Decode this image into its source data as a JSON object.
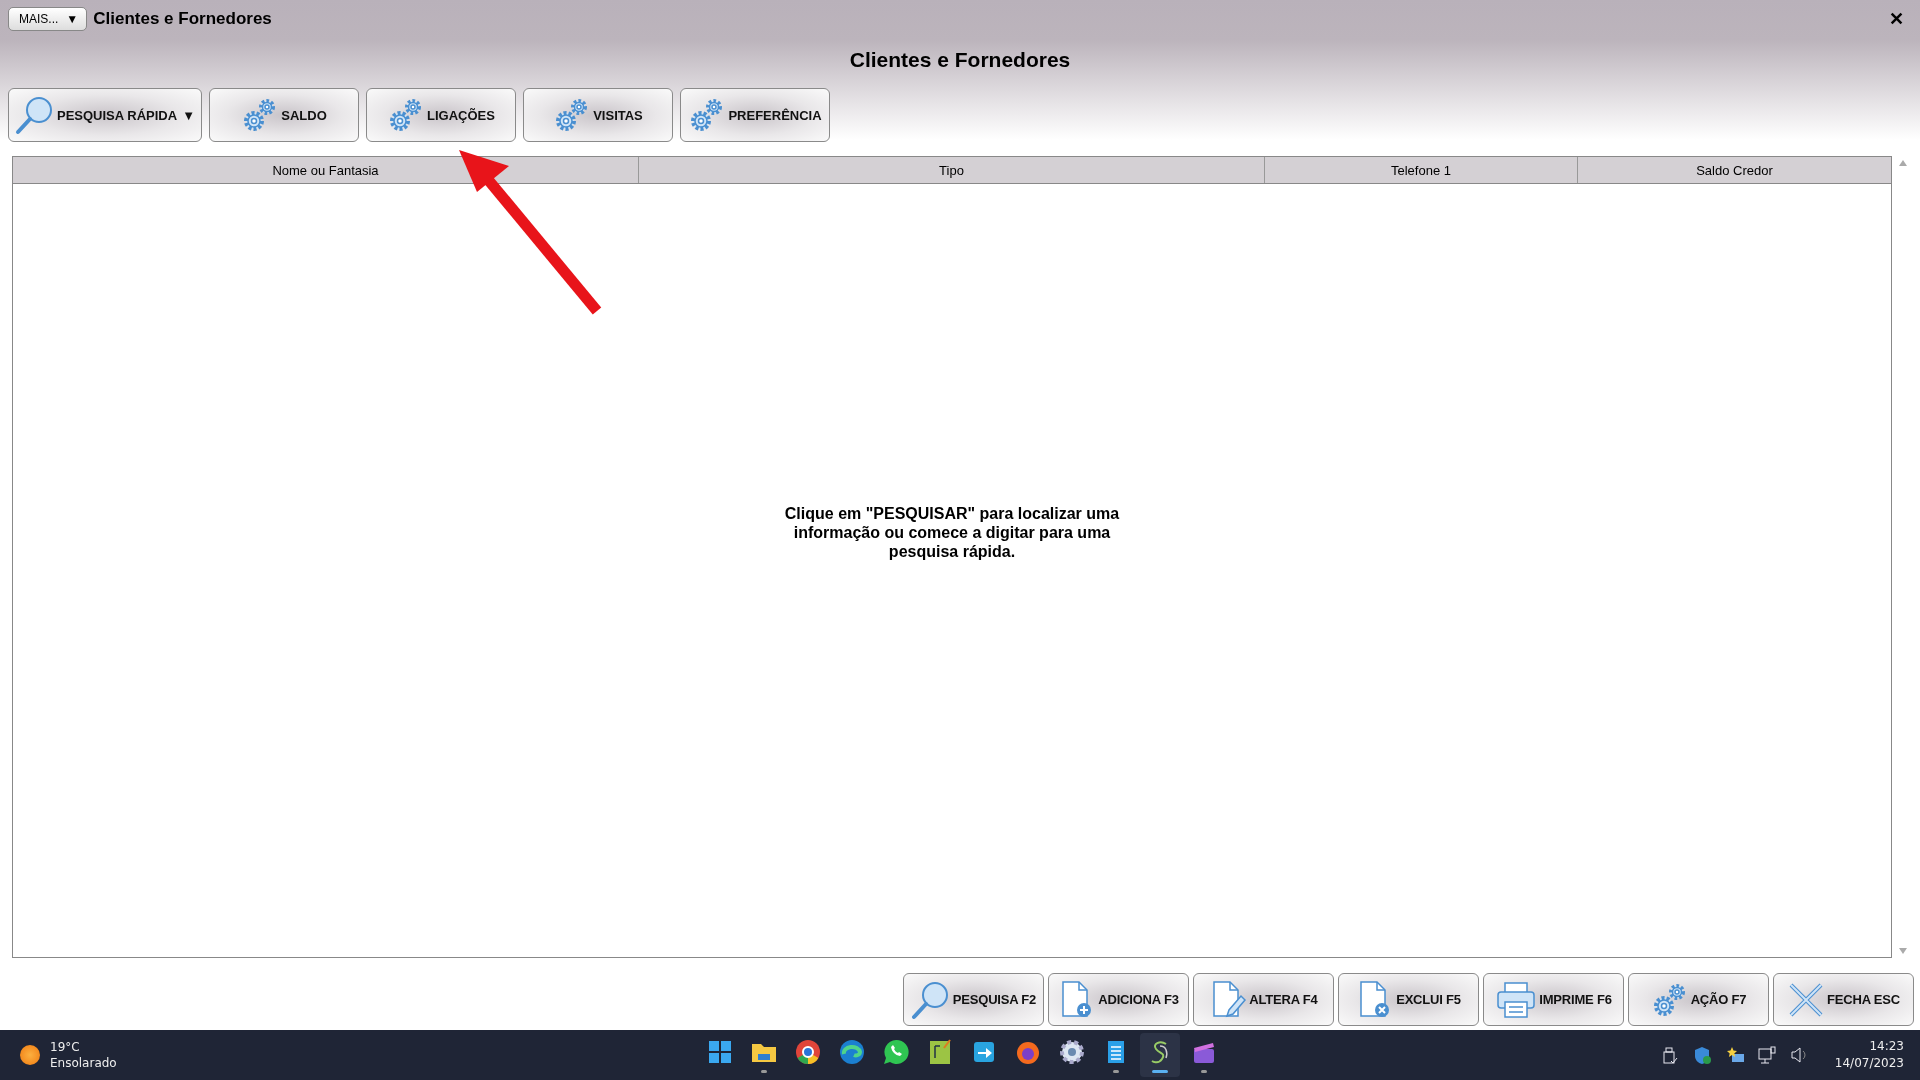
{
  "window": {
    "more_menu": "MAIS...",
    "more_caret": "▼",
    "title": "Clientes e Fornedores",
    "close": "✕"
  },
  "heading": "Clientes e Fornedores",
  "toolbar": [
    {
      "label": "PESQUISA RÁPIDA",
      "kind": "search",
      "dropdown": "▼"
    },
    {
      "label": "SALDO",
      "kind": "gears"
    },
    {
      "label": "LIGAÇÕES",
      "kind": "gears"
    },
    {
      "label": "VISITAS",
      "kind": "gears"
    },
    {
      "label": "PREFERÊNCIA",
      "kind": "gears"
    }
  ],
  "table": {
    "columns": [
      "Nome ou Fantasia",
      "Tipo",
      "Telefone 1",
      "Saldo Credor"
    ],
    "empty_message": "Clique em \"PESQUISAR\" para localizar uma informação ou comece a digitar para uma pesquisa rápida."
  },
  "actions": [
    {
      "label": "PESQUISA F2",
      "kind": "search"
    },
    {
      "label": "ADICIONA F3",
      "kind": "doc-add"
    },
    {
      "label": "ALTERA F4",
      "kind": "doc-edit"
    },
    {
      "label": "EXCLUI F5",
      "kind": "doc-delete"
    },
    {
      "label": "IMPRIME F6",
      "kind": "printer"
    },
    {
      "label": "AÇÃO F7",
      "kind": "gears"
    },
    {
      "label": "FECHA ESC",
      "kind": "close"
    }
  ],
  "taskbar": {
    "weather": {
      "temperature": "19°C",
      "condition": "Ensolarado"
    },
    "apps": [
      {
        "kind": "start",
        "running": false,
        "selected": false
      },
      {
        "kind": "folder",
        "running": true,
        "selected": false
      },
      {
        "kind": "chrome",
        "running": false,
        "selected": false
      },
      {
        "kind": "edge",
        "running": false,
        "selected": false
      },
      {
        "kind": "chat",
        "running": false,
        "selected": false
      },
      {
        "kind": "sheet",
        "running": false,
        "selected": false
      },
      {
        "kind": "transfer",
        "running": false,
        "selected": false
      },
      {
        "kind": "firefox",
        "running": false,
        "selected": false
      },
      {
        "kind": "gear",
        "running": false,
        "selected": false
      },
      {
        "kind": "notepad",
        "running": true,
        "selected": false
      },
      {
        "kind": "logo",
        "running": true,
        "selected": true
      },
      {
        "kind": "clapper",
        "running": true,
        "selected": false
      }
    ],
    "tray": [
      {
        "kind": "usb"
      },
      {
        "kind": "shield"
      },
      {
        "kind": "star"
      },
      {
        "kind": "network"
      },
      {
        "kind": "speaker"
      }
    ],
    "clock": {
      "time": "14:23",
      "date": "14/07/2023"
    }
  }
}
